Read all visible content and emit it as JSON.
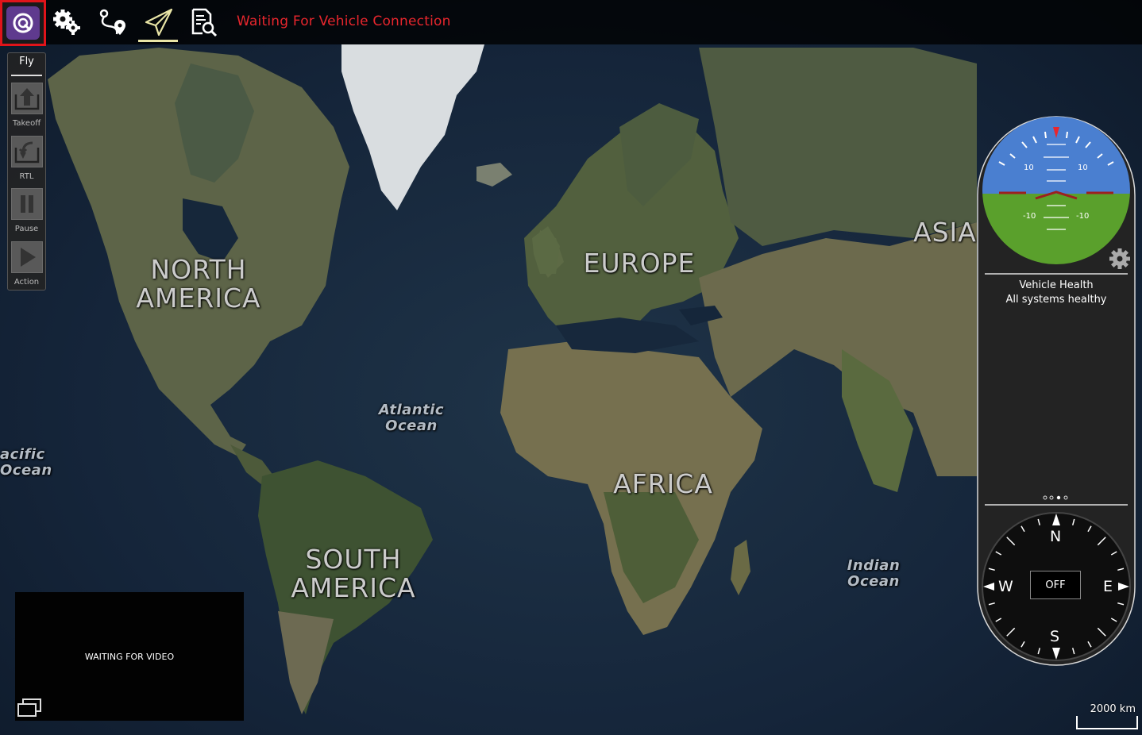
{
  "toolbar": {
    "status_text": "Waiting For Vehicle Connection",
    "buttons": [
      "app-logo",
      "settings",
      "plan",
      "fly",
      "analyze"
    ]
  },
  "fly_tools": {
    "title": "Fly",
    "items": [
      {
        "label": "Takeoff",
        "icon": "takeoff-icon"
      },
      {
        "label": "RTL",
        "icon": "rtl-icon"
      },
      {
        "label": "Pause",
        "icon": "pause-icon"
      },
      {
        "label": "Action",
        "icon": "action-icon"
      }
    ]
  },
  "map": {
    "labels": {
      "north_america_1": "NORTH",
      "north_america_2": "AMERICA",
      "south_america_1": "SOUTH",
      "south_america_2": "AMERICA",
      "europe": "EUROPE",
      "africa": "AFRICA",
      "asia": "ASIA",
      "atlantic_1": "Atlantic",
      "atlantic_2": "Ocean",
      "indian_1": "Indian",
      "indian_2": "Ocean",
      "pacific_1": "acific",
      "pacific_2": "Ocean"
    },
    "scale": "2000 km"
  },
  "video": {
    "message": "WAITING FOR VIDEO"
  },
  "instrument": {
    "attitude": {
      "pitch_labels": [
        "10",
        "10",
        "-10",
        "-10"
      ]
    },
    "vehicle_health_title": "Vehicle Health",
    "vehicle_health_status": "All systems healthy",
    "compass": {
      "n": "N",
      "s": "S",
      "e": "E",
      "w": "W",
      "heading": "OFF"
    }
  },
  "colors": {
    "status_red": "#e8262d",
    "logo_purple": "#5f3a8e",
    "sky": "#4a7fd0",
    "ground": "#5aa02c"
  }
}
